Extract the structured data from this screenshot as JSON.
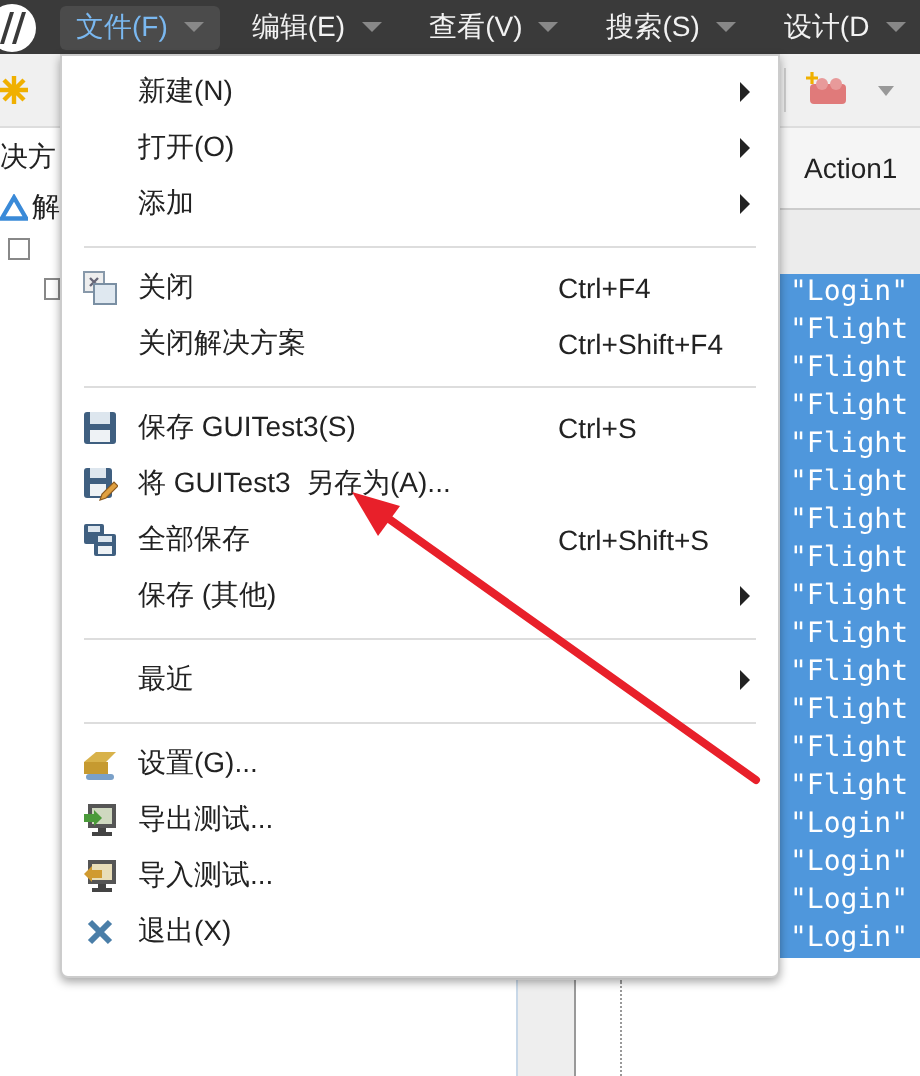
{
  "menubar": {
    "items": [
      {
        "label": "文件(F)",
        "selected": true
      },
      {
        "label": "编辑(E)",
        "selected": false
      },
      {
        "label": "查看(V)",
        "selected": false
      },
      {
        "label": "搜索(S)",
        "selected": false
      },
      {
        "label": "设计(D",
        "selected": false
      }
    ]
  },
  "file_menu": {
    "items": [
      {
        "kind": "item",
        "label": "新建(N)",
        "submenu": true
      },
      {
        "kind": "item",
        "label": "打开(O)",
        "submenu": true
      },
      {
        "kind": "item",
        "label": "添加",
        "submenu": true
      },
      {
        "kind": "separator"
      },
      {
        "kind": "item",
        "label": "关闭",
        "shortcut": "Ctrl+F4",
        "submenu": false
      },
      {
        "kind": "item",
        "label": "关闭解决方案",
        "shortcut": "Ctrl+Shift+F4",
        "submenu": false
      },
      {
        "kind": "separator"
      },
      {
        "kind": "item",
        "label": "保存 GUITest3(S)",
        "shortcut": "Ctrl+S",
        "submenu": false
      },
      {
        "kind": "item",
        "label": "将 GUITest3  另存为(A)...",
        "submenu": false
      },
      {
        "kind": "item",
        "label": "全部保存",
        "shortcut": "Ctrl+Shift+S",
        "submenu": false
      },
      {
        "kind": "item",
        "label": "保存 (其他)",
        "submenu": true
      },
      {
        "kind": "separator"
      },
      {
        "kind": "item",
        "label": "最近",
        "submenu": true
      },
      {
        "kind": "separator"
      },
      {
        "kind": "item",
        "label": "设置(G)...",
        "submenu": false
      },
      {
        "kind": "item",
        "label": "导出测试...",
        "submenu": false
      },
      {
        "kind": "item",
        "label": "导入测试...",
        "submenu": false
      },
      {
        "kind": "item",
        "label": "退出(X)",
        "submenu": false
      }
    ]
  },
  "solution_panel": {
    "title": "决方",
    "root_label": "解"
  },
  "editor": {
    "tab": "Action1",
    "lines": [
      "\"Login\"",
      "\"Flight",
      "\"Flight",
      "\"Flight",
      "\"Flight",
      "\"Flight",
      "\"Flight",
      "\"Flight",
      "\"Flight",
      "\"Flight",
      "\"Flight",
      "\"Flight",
      "\"Flight",
      "\"Flight",
      "\"Login\"",
      "\"Login\"",
      "\"Login\"",
      "\"Login\""
    ]
  }
}
